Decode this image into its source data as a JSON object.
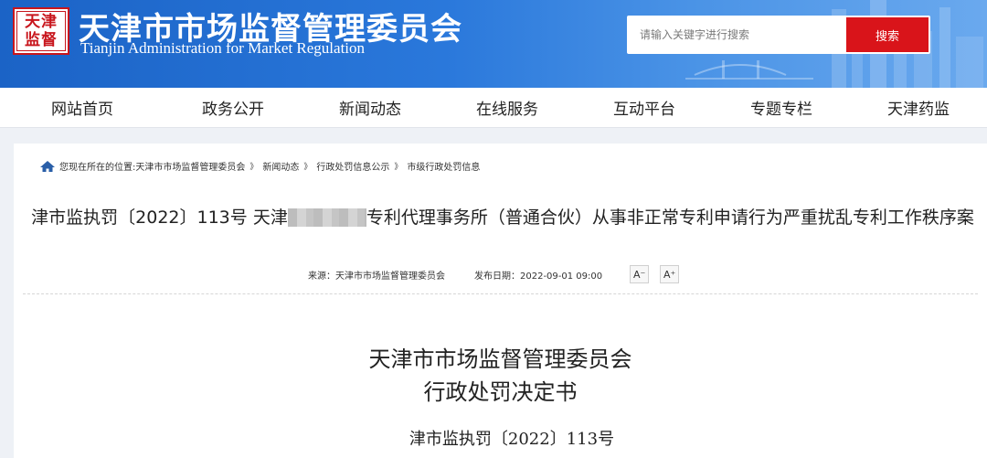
{
  "header": {
    "logo_text": "天津 监督",
    "title": "天津市市场监督管理委员会",
    "subtitle": "Tianjin Administration for Market Regulation"
  },
  "search": {
    "placeholder": "请输入关键字进行搜索",
    "button_label": "搜索"
  },
  "nav": {
    "items": [
      {
        "label": "网站首页"
      },
      {
        "label": "政务公开"
      },
      {
        "label": "新闻动态"
      },
      {
        "label": "在线服务"
      },
      {
        "label": "互动平台"
      },
      {
        "label": "专题专栏"
      },
      {
        "label": "天津药监"
      }
    ]
  },
  "breadcrumb": {
    "prefix": "您现在所在的位置:",
    "items": [
      {
        "label": "天津市市场监督管理委员会"
      },
      {
        "label": "新闻动态"
      },
      {
        "label": "行政处罚信息公示"
      },
      {
        "label": "市级行政处罚信息"
      }
    ],
    "separator": "》"
  },
  "article": {
    "title_part1": "津市监执罚〔2022〕113号 天津",
    "title_part2": "专利代理事务所（普通合伙）从事非正常专利申请行为严重扰乱专利工作秩序案",
    "source": "来源：天津市市场监督管理委员会",
    "date": "发布日期：2022-09-01 09:00",
    "font_smaller": "A⁻",
    "font_larger": "A⁺"
  },
  "document": {
    "org": "天津市市场监督管理委员会",
    "type": "行政处罚决定书",
    "number": "津市监执罚〔2022〕113号"
  },
  "colors": {
    "header_blue": "#2a78db",
    "search_red": "#d9141a",
    "seal_red": "#c8161d"
  }
}
